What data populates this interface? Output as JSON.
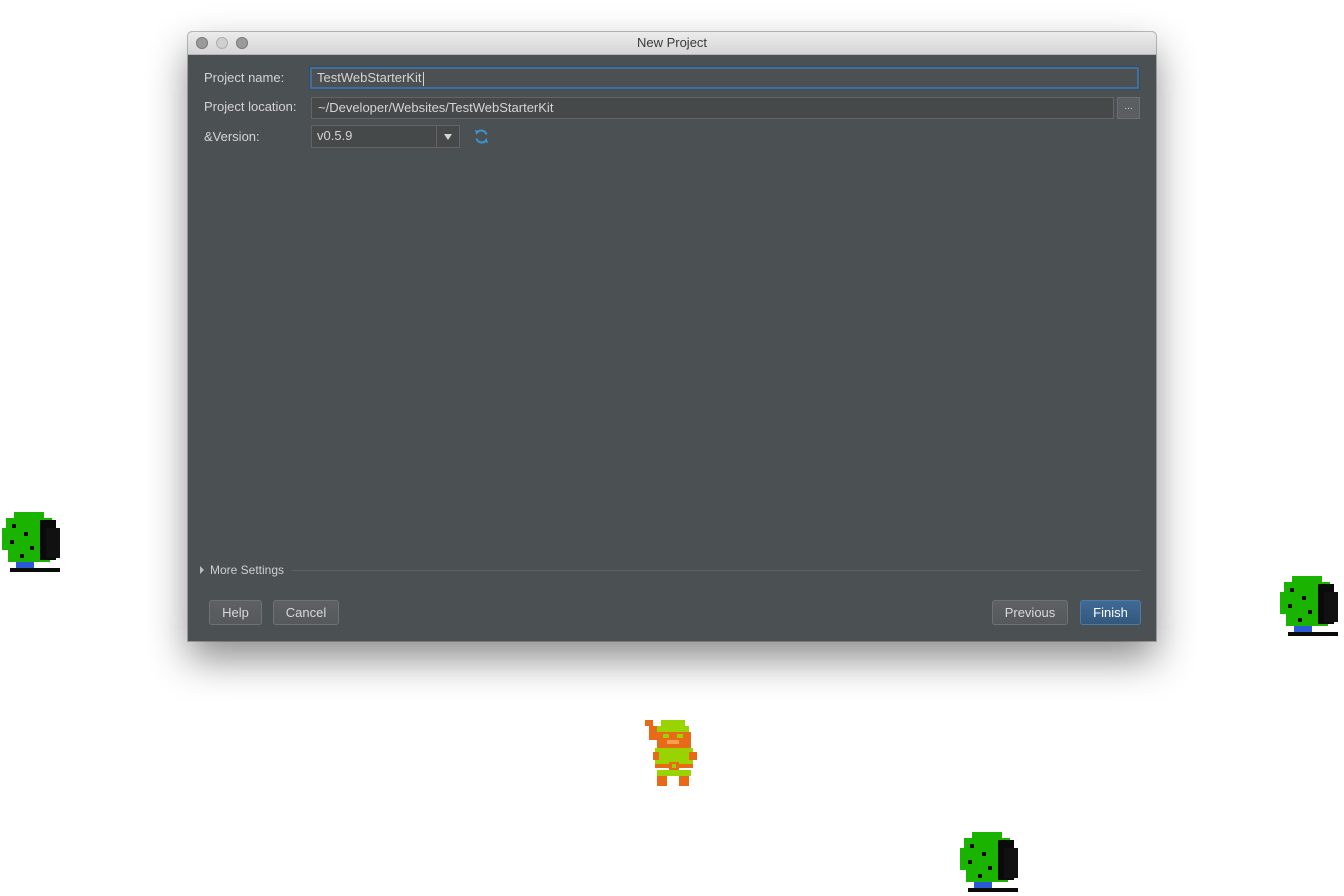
{
  "window": {
    "title": "New Project"
  },
  "form": {
    "project_name_label": "Project name:",
    "project_name_value": "TestWebStarterKit",
    "project_location_label": "Project location:",
    "project_location_value": "~/Developer/Websites/TestWebStarterKit",
    "browse_label": "...",
    "version_label": "&Version:",
    "version_value": "v0.5.9"
  },
  "more_settings": {
    "label": "More Settings"
  },
  "buttons": {
    "help": "Help",
    "cancel": "Cancel",
    "previous": "Previous",
    "finish": "Finish"
  },
  "icons": {
    "refresh": "refresh-icon",
    "dropdown": "chevron-down-icon",
    "disclosure": "disclosure-triangle-icon"
  },
  "colors": {
    "dialog_background": "#4b5053",
    "accent": "#3f6a96",
    "focus_border": "#466d94",
    "tree_green": "#19b300",
    "hero_green": "#9ad400",
    "hero_orange": "#e86a17"
  }
}
